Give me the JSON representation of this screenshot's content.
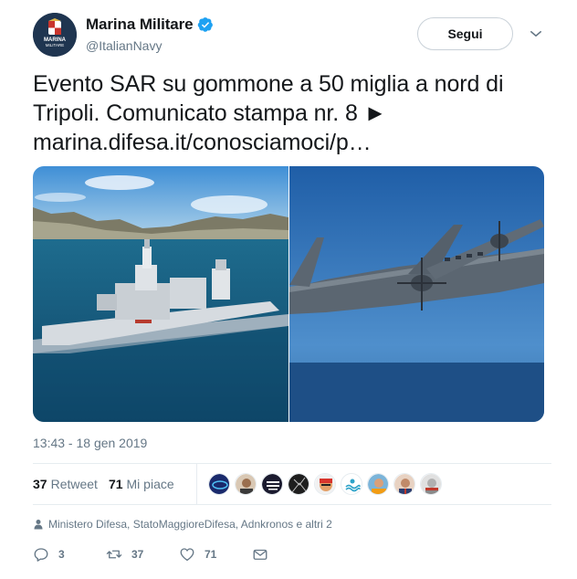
{
  "author": {
    "display_name": "Marina Militare",
    "handle": "@ItalianNavy",
    "avatar_text": "MARINA MILITARE",
    "verified": true
  },
  "follow_button": {
    "label": "Segui"
  },
  "more_menu": {
    "icon": "chevron-down-icon"
  },
  "tweet": {
    "text": "Evento SAR su gommone a 50 miglia a nord di Tripoli. Comunicato stampa nr. 8 ►",
    "link_text": "marina.difesa.it/conosciamoci/p…"
  },
  "media": [
    {
      "description_icon": "navy-ship-photo"
    },
    {
      "description_icon": "aircraft-photo"
    }
  ],
  "timestamp": "13:43 - 18 gen 2019",
  "stats": {
    "retweets_count": "37",
    "retweets_label": "Retweet",
    "likes_count": "71",
    "likes_label": "Mi piace"
  },
  "likers": [
    {
      "color": "#1a2a6c"
    },
    {
      "color": "#c9a27e"
    },
    {
      "color": "#1b1b2f"
    },
    {
      "color": "#1e1e1e"
    },
    {
      "color": "#d8342c"
    },
    {
      "color": "#2ea3c9"
    },
    {
      "color": "#7bb4d9"
    },
    {
      "color": "#e8d2c2"
    },
    {
      "color": "#cfcfcf"
    }
  ],
  "context": {
    "text": "Ministero Difesa, StatoMaggioreDifesa, Adnkronos e altri 2"
  },
  "actions": {
    "reply_count": "3",
    "retweet_count": "37",
    "like_count": "71"
  },
  "colors": {
    "verified_blue": "#1da1f2",
    "muted_text": "#657786",
    "primary_text": "#14171a",
    "divider": "#e6ecf0"
  }
}
